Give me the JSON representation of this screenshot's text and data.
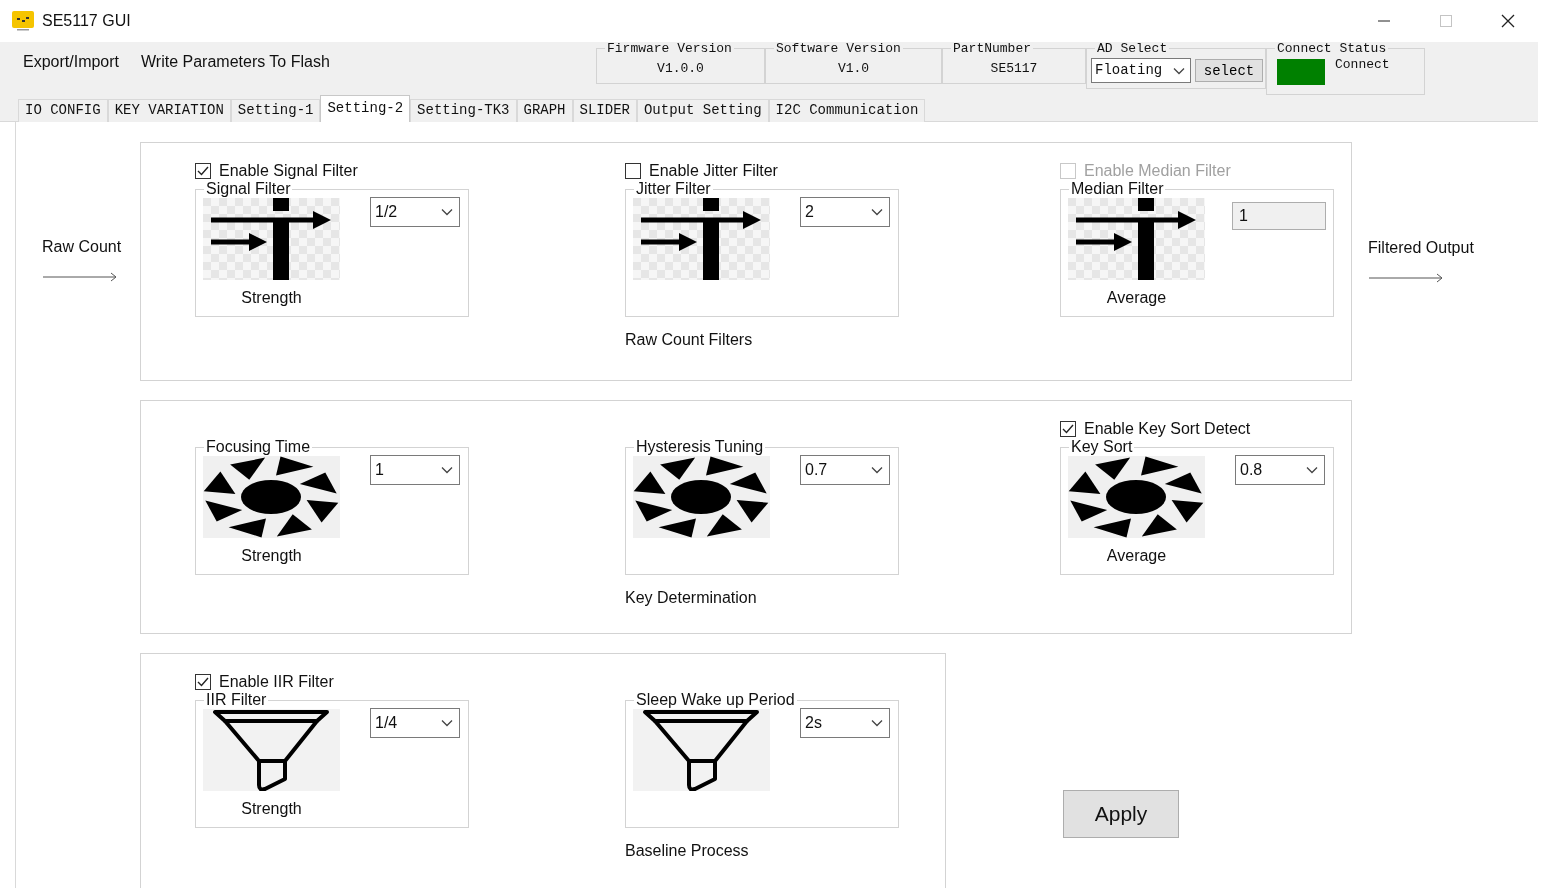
{
  "window": {
    "title": "SE5117 GUI"
  },
  "menu": [
    "Export/Import",
    "Write Parameters To Flash"
  ],
  "info": [
    {
      "label": "Firmware Version",
      "value": "V1.0.0"
    },
    {
      "label": "Software Version",
      "value": "V1.0"
    },
    {
      "label": "PartNumber",
      "value": "SE5117"
    }
  ],
  "ad_select": {
    "label": "AD Select",
    "value": "Floating",
    "button": "select"
  },
  "connect_status": {
    "label": "Connect Status",
    "connected": true,
    "text": "Connect"
  },
  "tabs": [
    {
      "label": "IO CONFIG",
      "selected": false
    },
    {
      "label": "KEY VARIATION",
      "selected": false
    },
    {
      "label": "Setting-1",
      "selected": false
    },
    {
      "label": "Setting-2",
      "selected": true
    },
    {
      "label": "Setting-TK3",
      "selected": false
    },
    {
      "label": "GRAPH",
      "selected": false
    },
    {
      "label": "SLIDER",
      "selected": false
    },
    {
      "label": "Output Setting",
      "selected": false
    },
    {
      "label": "I2C Communication",
      "selected": false
    }
  ],
  "input_label": "Raw Count",
  "output_label": "Filtered Output",
  "sections": [
    {
      "caption": "Raw Count Filters",
      "groups": [
        {
          "checkbox": {
            "label": "Enable Signal Filter",
            "checked": true,
            "disabled": false
          },
          "title": "Signal Filter",
          "field": {
            "kind": "combo",
            "value": "1/2"
          },
          "caption": "Strength"
        },
        {
          "checkbox": {
            "label": "Enable Jitter Filter",
            "checked": false,
            "disabled": false
          },
          "title": "Jitter Filter",
          "field": {
            "kind": "combo",
            "value": "2"
          }
        },
        {
          "checkbox": {
            "label": "Enable Median Filter",
            "checked": false,
            "disabled": true
          },
          "title": "Median Filter",
          "field": {
            "kind": "textbox",
            "value": "1"
          },
          "caption": "Average"
        }
      ]
    },
    {
      "caption": "Key Determination",
      "groups": [
        {
          "title": "Focusing Time",
          "field": {
            "kind": "combo",
            "value": "1"
          },
          "caption": "Strength"
        },
        {
          "title": "Hysteresis Tuning",
          "field": {
            "kind": "combo",
            "value": "0.7"
          }
        },
        {
          "checkbox": {
            "label": "Enable Key Sort Detect",
            "checked": true,
            "disabled": false
          },
          "title": "Key Sort",
          "field": {
            "kind": "combo",
            "value": "0.8"
          },
          "caption": "Average"
        }
      ]
    },
    {
      "caption": "Baseline Process",
      "groups": [
        {
          "checkbox": {
            "label": "Enable IIR Filter",
            "checked": true,
            "disabled": false
          },
          "title": "IIR Filter",
          "field": {
            "kind": "combo",
            "value": "1/4"
          },
          "caption": "Strength"
        },
        {
          "title": "Sleep Wake up Period",
          "field": {
            "kind": "combo",
            "value": "2s"
          }
        }
      ]
    }
  ],
  "apply_button": "Apply"
}
